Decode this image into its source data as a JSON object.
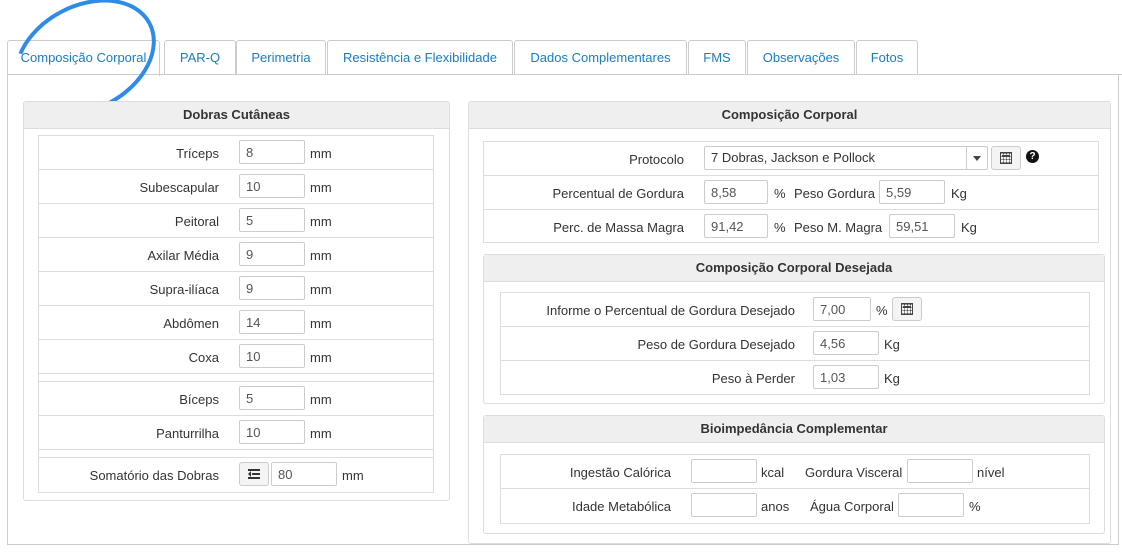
{
  "tabs": [
    {
      "label": "Composição Corporal",
      "active": true
    },
    {
      "label": "PAR-Q"
    },
    {
      "label": "Perimetria"
    },
    {
      "label": "Resistência e Flexibilidade"
    },
    {
      "label": "Dados Complementares"
    },
    {
      "label": "FMS"
    },
    {
      "label": "Observações"
    },
    {
      "label": "Fotos"
    }
  ],
  "skinfolds": {
    "title": "Dobras Cutâneas",
    "unit": "mm",
    "items": [
      {
        "label": "Tríceps",
        "value": "8"
      },
      {
        "label": "Subescapular",
        "value": "10"
      },
      {
        "label": "Peitoral",
        "value": "5"
      },
      {
        "label": "Axilar Média",
        "value": "9"
      },
      {
        "label": "Supra-ilíaca",
        "value": "9"
      },
      {
        "label": "Abdômen",
        "value": "14"
      },
      {
        "label": "Coxa",
        "value": "10"
      }
    ],
    "extra": [
      {
        "label": "Bíceps",
        "value": "5"
      },
      {
        "label": "Panturrilha",
        "value": "10"
      }
    ],
    "sum": {
      "label": "Somatório das Dobras",
      "value": "80"
    }
  },
  "composition": {
    "title": "Composição Corporal",
    "protocol_label": "Protocolo",
    "protocol_value": "7 Dobras, Jackson e Pollock",
    "fat_pct_label": "Percentual de Gordura",
    "fat_pct_value": "8,58",
    "pct_unit": "%",
    "fat_weight_label": "Peso Gordura",
    "fat_weight_value": "5,59",
    "kg_unit": "Kg",
    "lean_pct_label": "Perc. de Massa Magra",
    "lean_pct_value": "91,42",
    "lean_weight_label": "Peso M. Magra",
    "lean_weight_value": "59,51",
    "help": "?"
  },
  "desired": {
    "title": "Composição Corporal Desejada",
    "pct_label": "Informe o Percentual de Gordura Desejado",
    "pct_value": "7,00",
    "pct_unit": "%",
    "fat_label": "Peso de Gordura Desejado",
    "fat_value": "4,56",
    "kg_unit": "Kg",
    "lose_label": "Peso à Perder",
    "lose_value": "1,03"
  },
  "bio": {
    "title": "Bioimpedância Complementar",
    "caloric_label": "Ingestão Calórica",
    "caloric_unit": "kcal",
    "caloric_value": "",
    "visceral_label": "Gordura Visceral",
    "visceral_unit": "nível",
    "visceral_value": "",
    "age_label": "Idade Metabólica",
    "age_unit": "anos",
    "age_value": "",
    "water_label": "Água Corporal",
    "water_unit": "%",
    "water_value": ""
  },
  "colors": {
    "link": "#1a7cc2",
    "highlight_circle": "#2e8be8"
  }
}
